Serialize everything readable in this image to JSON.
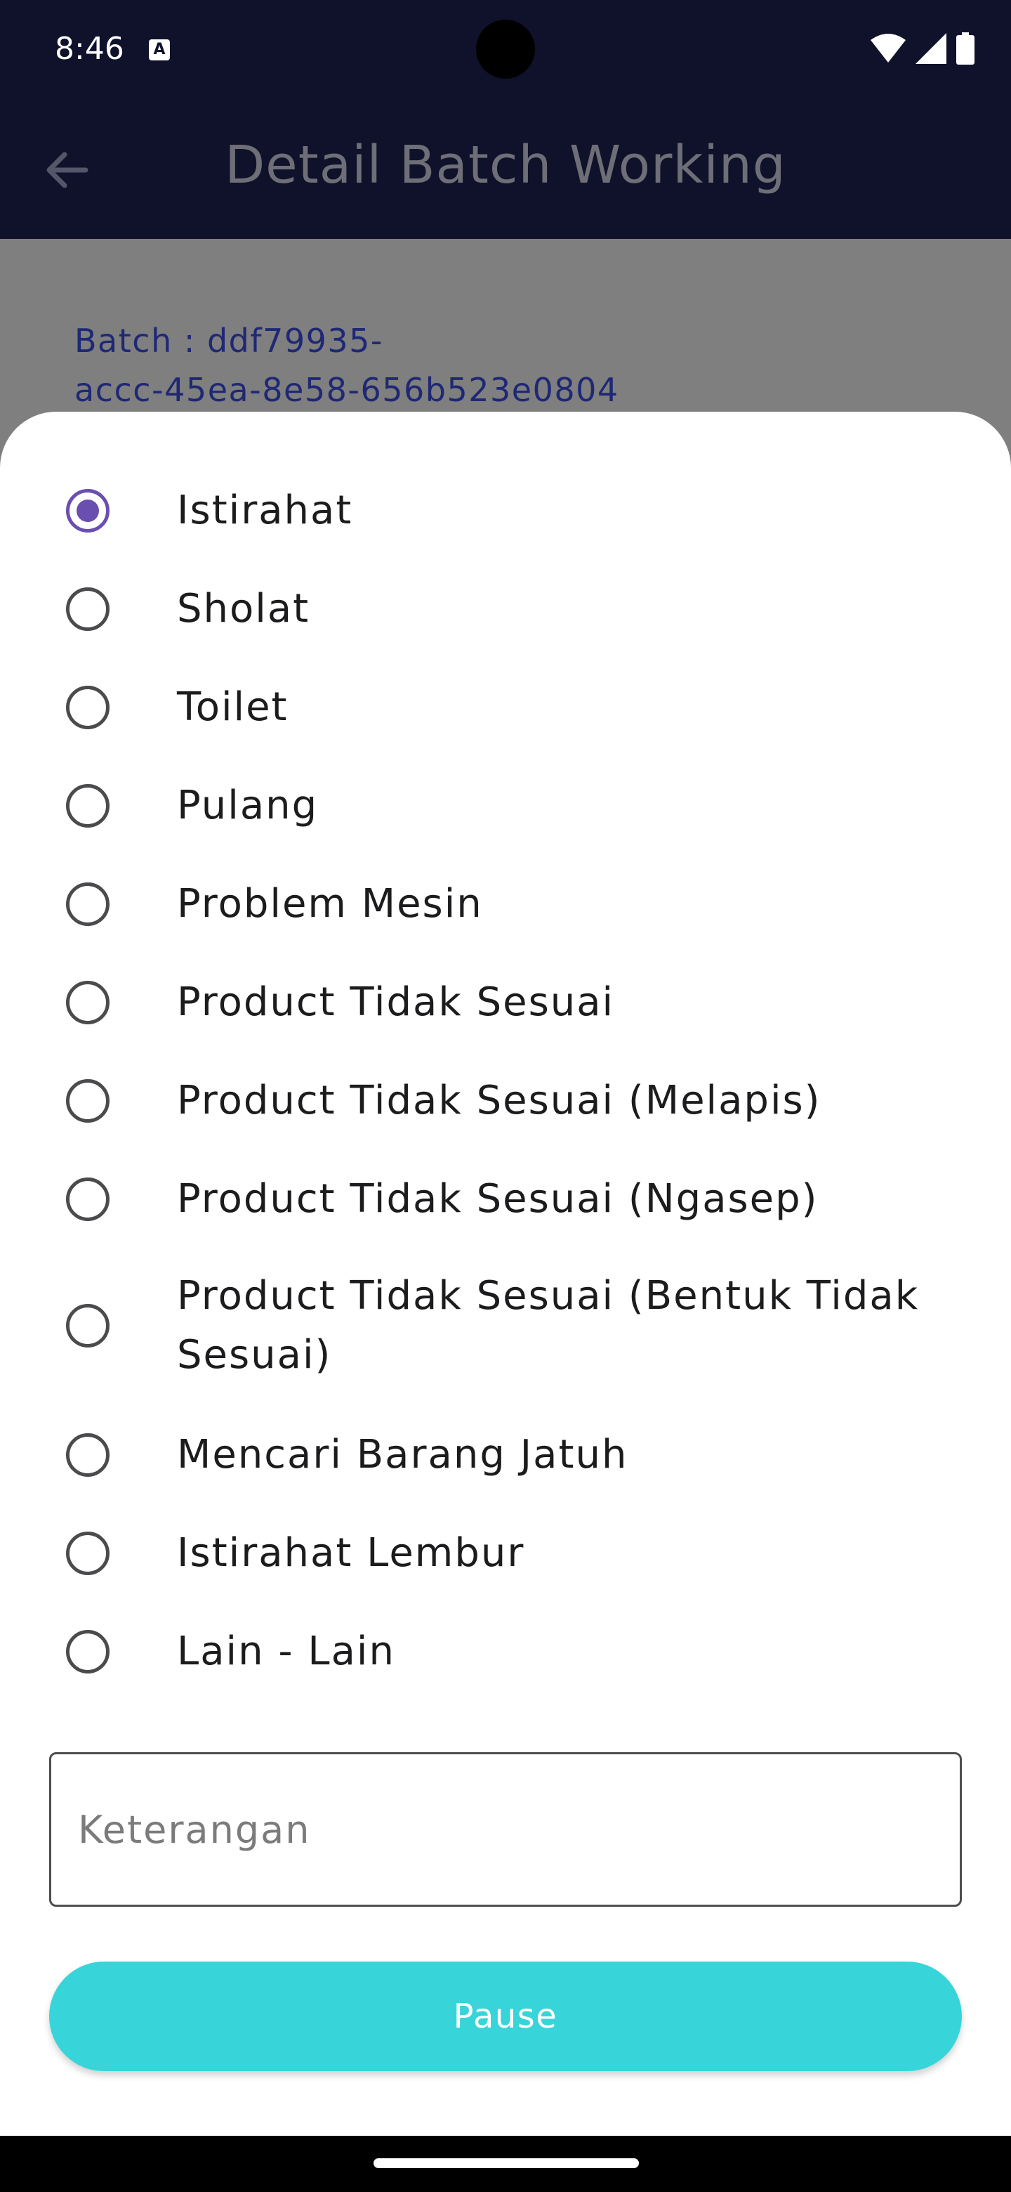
{
  "status_bar": {
    "time": "8:46",
    "notification_glyph": "A",
    "icons": [
      "wifi-icon",
      "signal-icon",
      "battery-icon"
    ]
  },
  "app_bar": {
    "title": "Detail Batch Working",
    "back_icon": "arrow-left-icon"
  },
  "batch": {
    "line1": "Batch : ddf79935-",
    "line2": "accc-45ea-8e58-656b523e0804"
  },
  "sheet": {
    "options": [
      {
        "label": "Istirahat",
        "checked": true
      },
      {
        "label": "Sholat",
        "checked": false
      },
      {
        "label": "Toilet",
        "checked": false
      },
      {
        "label": "Pulang",
        "checked": false
      },
      {
        "label": "Problem Mesin",
        "checked": false
      },
      {
        "label": "Product Tidak Sesuai",
        "checked": false
      },
      {
        "label": "Product Tidak Sesuai (Melapis)",
        "checked": false
      },
      {
        "label": "Product Tidak Sesuai (Ngasep)",
        "checked": false
      },
      {
        "label": "Product Tidak Sesuai (Bentuk Tidak Sesuai)",
        "checked": false
      },
      {
        "label": "Mencari Barang Jatuh",
        "checked": false
      },
      {
        "label": "Istirahat Lembur",
        "checked": false
      },
      {
        "label": "Lain - Lain",
        "checked": false
      }
    ],
    "keterangan": {
      "placeholder": "Keterangan",
      "value": ""
    },
    "pause_label": "Pause"
  },
  "colors": {
    "app_bar": "#10112a",
    "radio_selected": "#6a4fb0",
    "pause_button": "#37d4d9",
    "batch_text": "#1f2875"
  }
}
